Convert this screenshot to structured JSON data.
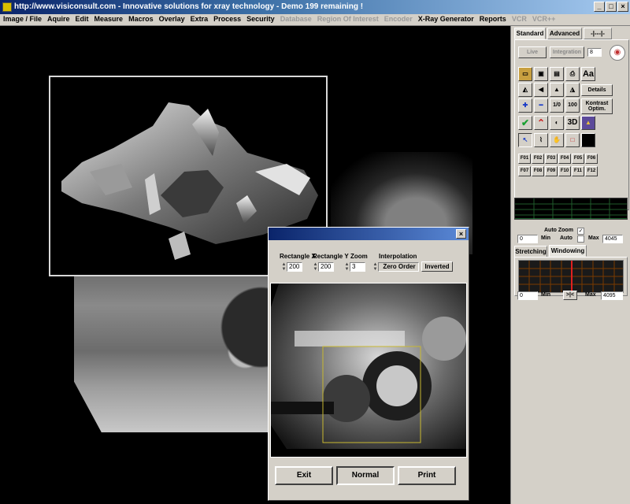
{
  "title_bar": {
    "text": "http://www.visiconsult.com  - Innovative solutions for xray technology       - Demo 199 remaining !",
    "minimize": "_",
    "maximize": "□",
    "close": "×"
  },
  "menu": [
    {
      "label": "Image / File",
      "enabled": true
    },
    {
      "label": "Aquire",
      "enabled": true
    },
    {
      "label": "Edit",
      "enabled": true
    },
    {
      "label": "Measure",
      "enabled": true
    },
    {
      "label": "Macros",
      "enabled": true
    },
    {
      "label": "Overlay",
      "enabled": true
    },
    {
      "label": "Extra",
      "enabled": true
    },
    {
      "label": "Process",
      "enabled": true
    },
    {
      "label": "Security",
      "enabled": true
    },
    {
      "label": "Database",
      "enabled": false
    },
    {
      "label": "Region Of Interest",
      "enabled": false
    },
    {
      "label": "Encoder",
      "enabled": false
    },
    {
      "label": "X-Ray Generator",
      "enabled": true
    },
    {
      "label": "Reports",
      "enabled": true
    },
    {
      "label": "VCR",
      "enabled": false
    },
    {
      "label": "VCR++",
      "enabled": false
    }
  ],
  "zoom_dialog": {
    "close": "×",
    "rect_x_label": "Rectangle X",
    "rect_y_label": "Rectangle Y",
    "zoom_label": "Zoom",
    "interp_label": "Interpolation",
    "rect_x": "200",
    "rect_y": "200",
    "zoom": "3",
    "interp_value": "Zero Order",
    "inverted": "Inverted",
    "exit": "Exit",
    "normal": "Normal",
    "print": "Print"
  },
  "panel": {
    "tabs": [
      "Standard",
      "Advanced",
      "-|---|-"
    ],
    "live": "Live",
    "integration": "Integration",
    "integration_value": "8",
    "details": "Details",
    "kontrast": "Kontrast Optim.",
    "tool_labels": {
      "aa": "Aa",
      "threed": "3D",
      "onezero": "1/0",
      "hundred": "100"
    },
    "fkeys": [
      "F01",
      "F02",
      "F03",
      "F04",
      "F05",
      "F06",
      "F07",
      "F08",
      "F09",
      "F10",
      "F11",
      "F12"
    ],
    "auto_zoom": "Auto Zoom",
    "auto": "Auto",
    "min_label": "Min",
    "max_label": "Max",
    "min_value": "0",
    "max_value": "4045",
    "stretching": "Stretching",
    "windowing": "Windowing",
    "win_min": "0",
    "win_max": "4095",
    "win_min_label": "Min",
    "win_max_label": "Max",
    "swap": ">|<"
  }
}
